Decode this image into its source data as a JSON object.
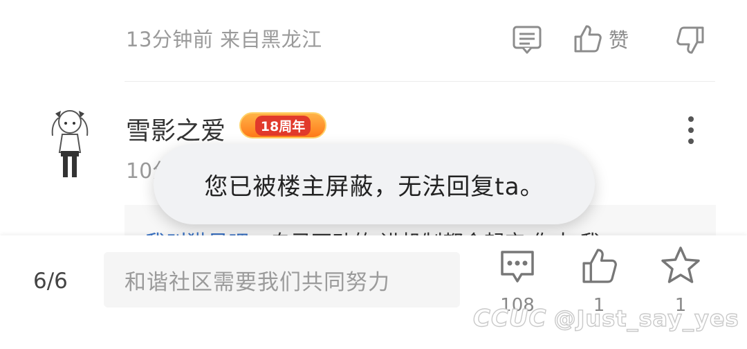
{
  "prev_comment": {
    "meta": "13分钟前 来自黑龙江",
    "like_label": "赞"
  },
  "comment": {
    "username": "雪影之爱",
    "badge": "18周年",
    "time_partial": "10分",
    "quote_mention": "我叫猫贝吧",
    "quote_text": "，自己不动的 进机制都会起它 你太 我"
  },
  "toast": {
    "message": "您已被楼主屏蔽，无法回复ta。"
  },
  "bottom_bar": {
    "page": "6/6",
    "input_placeholder": "和谐社区需要我们共同努力",
    "comment_count": "108",
    "like_count": "1",
    "star_count": "1"
  },
  "watermark": {
    "logo": "CCUC",
    "handle": "@Just_say_yes"
  },
  "colors": {
    "link": "#3b73c4",
    "muted": "#9a9a9a",
    "toast_bg": "#f1f2f4"
  }
}
